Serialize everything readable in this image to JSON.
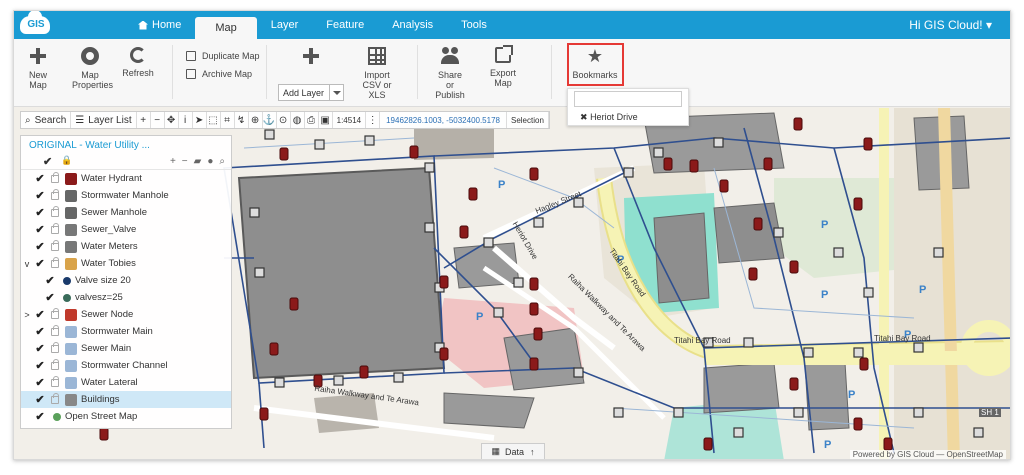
{
  "app": {
    "logo_text": "GIS",
    "greeting": "Hi GIS Cloud!"
  },
  "tabs": [
    {
      "label": "Home",
      "active": false
    },
    {
      "label": "Map",
      "active": true
    },
    {
      "label": "Layer",
      "active": false
    },
    {
      "label": "Feature",
      "active": false
    },
    {
      "label": "Analysis",
      "active": false
    },
    {
      "label": "Tools",
      "active": false
    }
  ],
  "ribbon": {
    "new_map": "New Map",
    "map_properties": "Map Properties",
    "refresh": "Refresh",
    "duplicate_map": "Duplicate Map",
    "archive_map": "Archive Map",
    "add_layer": "Add Layer",
    "import_csv": "Import CSV or XLS",
    "share_publish": "Share or Publish",
    "export_map": "Export Map",
    "bookmarks": "Bookmarks",
    "highlight_color": "#e53935"
  },
  "bookmark_dropdown": {
    "input_value": "",
    "items": [
      "Heriot Drive"
    ]
  },
  "map_toolbar": {
    "search": "Search",
    "layer_list": "Layer List",
    "scale": "1:4514",
    "coordinates": "19462826.1003, -5032400.5178",
    "selection": "Selection"
  },
  "layer_panel": {
    "title": "ORIGINAL - Water Utility ...",
    "layers": [
      {
        "label": "Water Hydrant",
        "expand": "",
        "checked": true,
        "symbol": "#8b1a1a",
        "indent": 0,
        "selected": false
      },
      {
        "label": "Stormwater Manhole",
        "expand": "",
        "checked": true,
        "symbol": "#666666",
        "indent": 0,
        "selected": false
      },
      {
        "label": "Sewer Manhole",
        "expand": "",
        "checked": true,
        "symbol": "#666666",
        "indent": 0,
        "selected": false
      },
      {
        "label": "Sewer_Valve",
        "expand": "",
        "checked": true,
        "symbol": "#777777",
        "indent": 0,
        "selected": false
      },
      {
        "label": "Water Meters",
        "expand": "",
        "checked": true,
        "symbol": "#777777",
        "indent": 0,
        "selected": false
      },
      {
        "label": "Water Tobies",
        "expand": "v",
        "checked": true,
        "symbol": "#d9a34a",
        "indent": 0,
        "selected": false
      },
      {
        "label": "Valve size 20",
        "expand": "",
        "checked": true,
        "symbol": "#1a3a6b",
        "indent": 1,
        "selected": false
      },
      {
        "label": "valvesz=25",
        "expand": "",
        "checked": true,
        "symbol": "#3a6b5a",
        "indent": 1,
        "selected": false
      },
      {
        "label": "Sewer Node",
        "expand": ">",
        "checked": true,
        "symbol": "#c0392b",
        "indent": 0,
        "selected": false
      },
      {
        "label": "Stormwater Main",
        "expand": "",
        "checked": true,
        "symbol": "#9bb6d6",
        "indent": 0,
        "selected": false
      },
      {
        "label": "Sewer Main",
        "expand": "",
        "checked": true,
        "symbol": "#9bb6d6",
        "indent": 0,
        "selected": false
      },
      {
        "label": "Stormwater Channel",
        "expand": "",
        "checked": true,
        "symbol": "#9bb6d6",
        "indent": 0,
        "selected": false
      },
      {
        "label": "Water Lateral",
        "expand": "",
        "checked": true,
        "symbol": "#9bb6d6",
        "indent": 0,
        "selected": false
      },
      {
        "label": "Buildings",
        "expand": "",
        "checked": true,
        "symbol": "#888888",
        "indent": 0,
        "selected": true
      },
      {
        "label": "Open Street Map",
        "expand": "",
        "checked": true,
        "symbol": "#5aa05a",
        "indent": -1,
        "selected": false
      }
    ]
  },
  "map_labels": {
    "streets": [
      "Hagley Street",
      "Heriot Drive",
      "Titahi Bay Road",
      "Raiha Walkway and Te Arawa",
      "Raiha Walkway and Te Arawa",
      "Titahi Bay Road",
      "Titahi Bay Road"
    ],
    "shield": "SH 1"
  },
  "data_tab": "Data",
  "attribution": "Powered by GIS Cloud — OpenStreetMap"
}
